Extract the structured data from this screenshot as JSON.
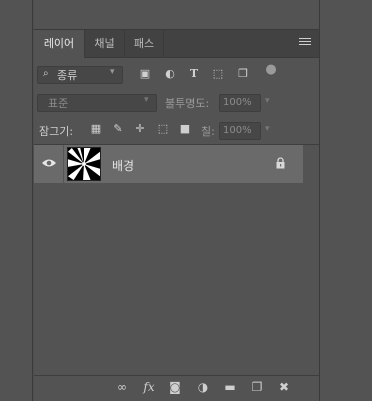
{
  "tabs": [
    {
      "label": "레이어",
      "active": true
    },
    {
      "label": "채널",
      "active": false
    },
    {
      "label": "패스",
      "active": false
    }
  ],
  "filter": {
    "kind_label": "종류"
  },
  "blend": {
    "mode": "표준",
    "opacity_label": "불투명도:",
    "opacity_value": "100%"
  },
  "lock": {
    "label": "잠그기:",
    "fill_label": "칠:",
    "fill_value": "100%"
  },
  "layers": [
    {
      "name": "배경",
      "visible": true,
      "locked": true
    }
  ],
  "colors": {
    "panel_bg": "#535353",
    "tab_bar_bg": "#424242",
    "selected_row": "#6a6a6a"
  }
}
